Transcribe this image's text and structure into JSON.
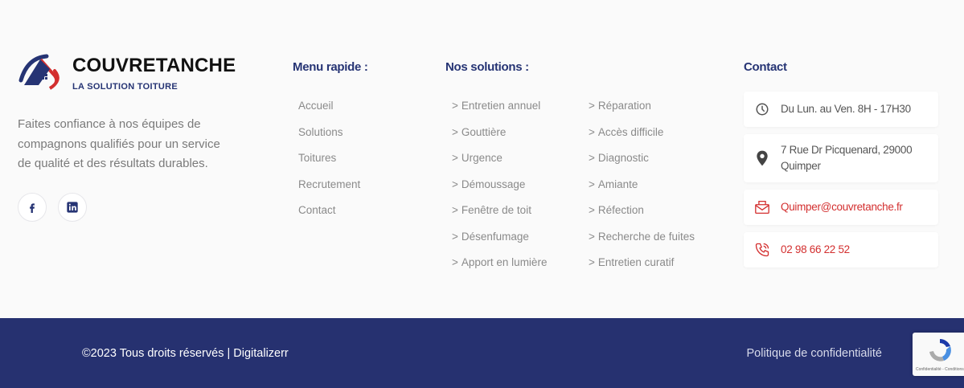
{
  "brand": {
    "name": "COUVRETANCHE",
    "subtitle": "LA SOLUTION TOITURE",
    "tagline": "Faites confiance à nos équipes de compagnons qualifiés pour un service de qualité et des résultats durables."
  },
  "socials": [
    {
      "icon": "facebook-icon"
    },
    {
      "icon": "linkedin-icon"
    }
  ],
  "menu_rapide": {
    "title": "Menu rapide :",
    "items": [
      "Accueil",
      "Solutions",
      "Toitures",
      "Recrutement",
      "Contact"
    ]
  },
  "solutions": {
    "title": "Nos solutions :",
    "chevron": ">",
    "col1": [
      "Entretien annuel",
      "Gouttière",
      "Urgence",
      "Démoussage",
      "Fenêtre de toit",
      "Désenfumage",
      "Apport en lumière"
    ],
    "col2": [
      "Réparation",
      "Accès difficile",
      "Diagnostic",
      "Amiante",
      "Réfection",
      "Recherche de fuites",
      "Entretien curatif"
    ]
  },
  "contact": {
    "title": "Contact",
    "hours": "Du Lun. au Ven. 8H - 17H30",
    "address": "7 Rue Dr Picquenard, 29000 Quimper",
    "email": "Quimper@couvretanche.fr",
    "phone": "02 98 66 22 52"
  },
  "footer": {
    "copyright": "©2023 Tous droits réservés | Digitalizerr",
    "policy": "Politique de confidentialité",
    "recaptcha_terms": "Confidentialité - Conditions"
  },
  "colors": {
    "navy": "#263170",
    "accent_red": "#d32f2f",
    "text_gray": "#8a8a8a"
  }
}
